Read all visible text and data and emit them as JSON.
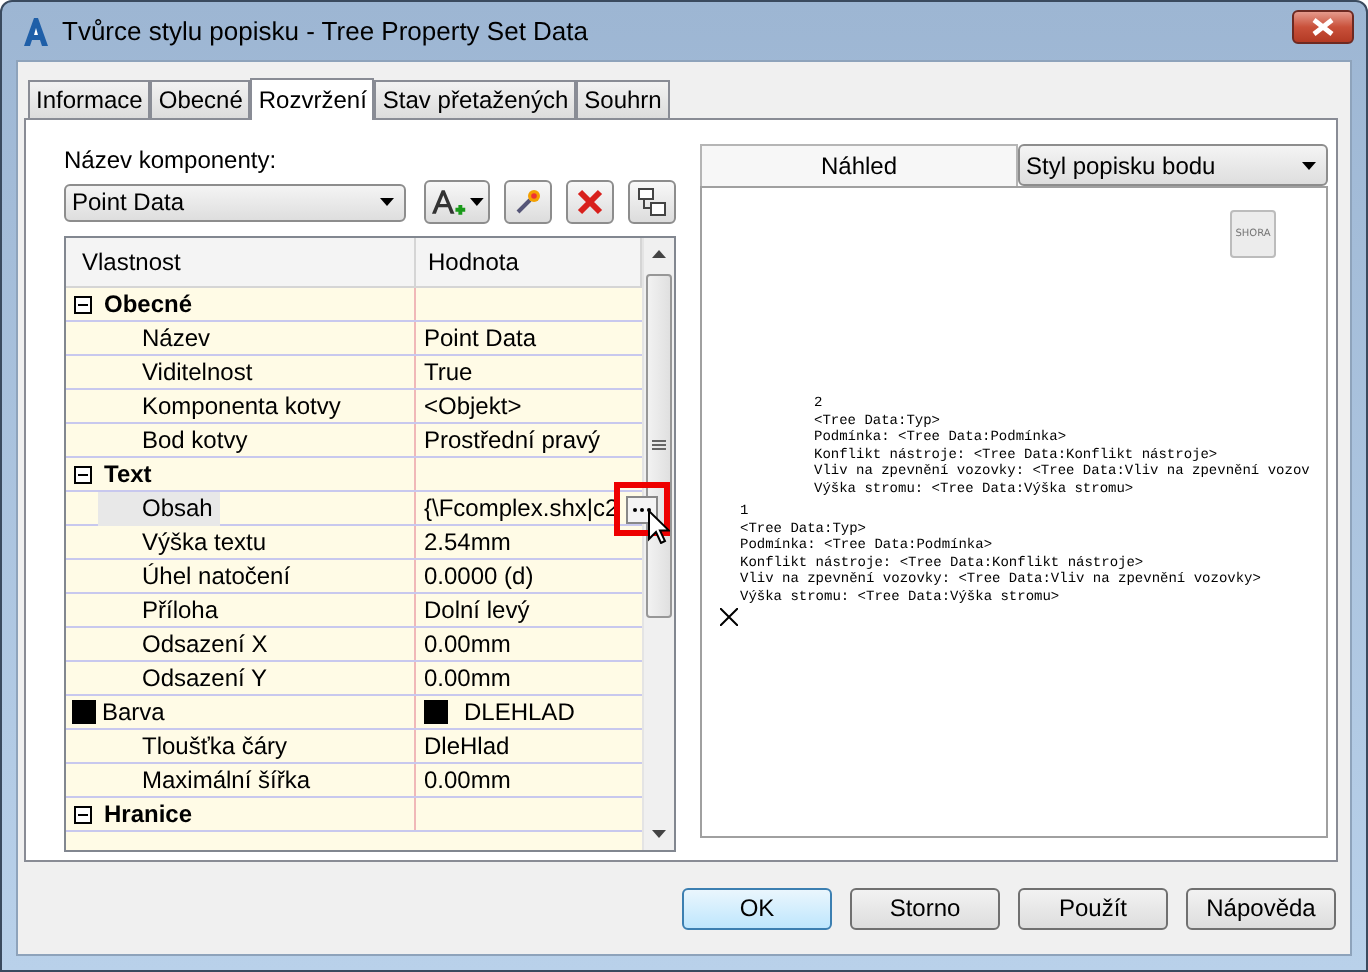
{
  "window": {
    "title": "Tvůrce stylu popisku - Tree Property Set Data"
  },
  "tabs": [
    {
      "label": "Informace",
      "selected": false
    },
    {
      "label": "Obecné",
      "selected": false
    },
    {
      "label": "Rozvržení",
      "selected": true
    },
    {
      "label": "Stav přetažených",
      "selected": false
    },
    {
      "label": "Souhrn",
      "selected": false
    }
  ],
  "component": {
    "label": "Název komponenty:",
    "value": "Point Data"
  },
  "grid": {
    "columns": [
      "Vlastnost",
      "Hodnota"
    ],
    "categories": [
      {
        "name": "Obecné",
        "expanded": true,
        "rows": [
          {
            "kind": "text",
            "name": "Název",
            "value": "Point Data",
            "selected": false
          },
          {
            "kind": "text",
            "name": "Viditelnost",
            "value": "True",
            "selected": false
          },
          {
            "kind": "text",
            "name": "Komponenta kotvy",
            "value": "<Objekt>",
            "selected": false
          },
          {
            "kind": "text",
            "name": "Bod kotvy",
            "value": "Prostřední pravý",
            "selected": false
          }
        ]
      },
      {
        "name": "Text",
        "expanded": true,
        "rows": [
          {
            "kind": "editor",
            "name": "Obsah",
            "value": "{\\Fcomplex.shx|c2",
            "selected": true
          },
          {
            "kind": "text",
            "name": "Výška textu",
            "value": "2.54mm",
            "selected": false
          },
          {
            "kind": "text",
            "name": "Úhel natočení",
            "value": "0.0000 (d)",
            "selected": false
          },
          {
            "kind": "text",
            "name": "Příloha",
            "value": "Dolní levý",
            "selected": false
          },
          {
            "kind": "text",
            "name": "Odsazení X",
            "value": "0.00mm",
            "selected": false
          },
          {
            "kind": "text",
            "name": "Odsazení Y",
            "value": "0.00mm",
            "selected": false
          },
          {
            "kind": "color",
            "name": "Barva",
            "value": "DLEHLAD",
            "color": "#000000",
            "selected": false
          },
          {
            "kind": "text",
            "name": "Tloušťka čáry",
            "value": "DleHlad",
            "selected": false
          },
          {
            "kind": "text",
            "name": "Maximální šířka",
            "value": "0.00mm",
            "selected": false
          }
        ]
      },
      {
        "name": "Hranice",
        "expanded": true
      }
    ]
  },
  "preview": {
    "tab": "Náhled",
    "style_select": "Styl popisku bodu",
    "view_button": "SHORA",
    "labels": [
      {
        "lines": [
          "2",
          "<Tree Data:Typ>",
          "Podmínka: <Tree Data:Podmínka>",
          "Konflikt nástroje: <Tree Data:Konflikt nástroje>",
          "Vliv na zpevnění vozovky: <Tree Data:Vliv na zpevnění vozov",
          "Výška stromu: <Tree Data:Výška stromu>"
        ]
      },
      {
        "lines": [
          "1",
          "<Tree Data:Typ>",
          "Podmínka: <Tree Data:Podmínka>",
          "Konflikt nástroje: <Tree Data:Konflikt nástroje>",
          "Vliv na zpevnění vozovky: <Tree Data:Vliv na zpevnění vozovky>",
          "Výška stromu: <Tree Data:Výška stromu>"
        ]
      }
    ]
  },
  "buttons": [
    {
      "label": "OK",
      "default": true
    },
    {
      "label": "Storno",
      "default": false
    },
    {
      "label": "Použít",
      "default": false
    },
    {
      "label": "Nápověda",
      "default": false
    }
  ]
}
